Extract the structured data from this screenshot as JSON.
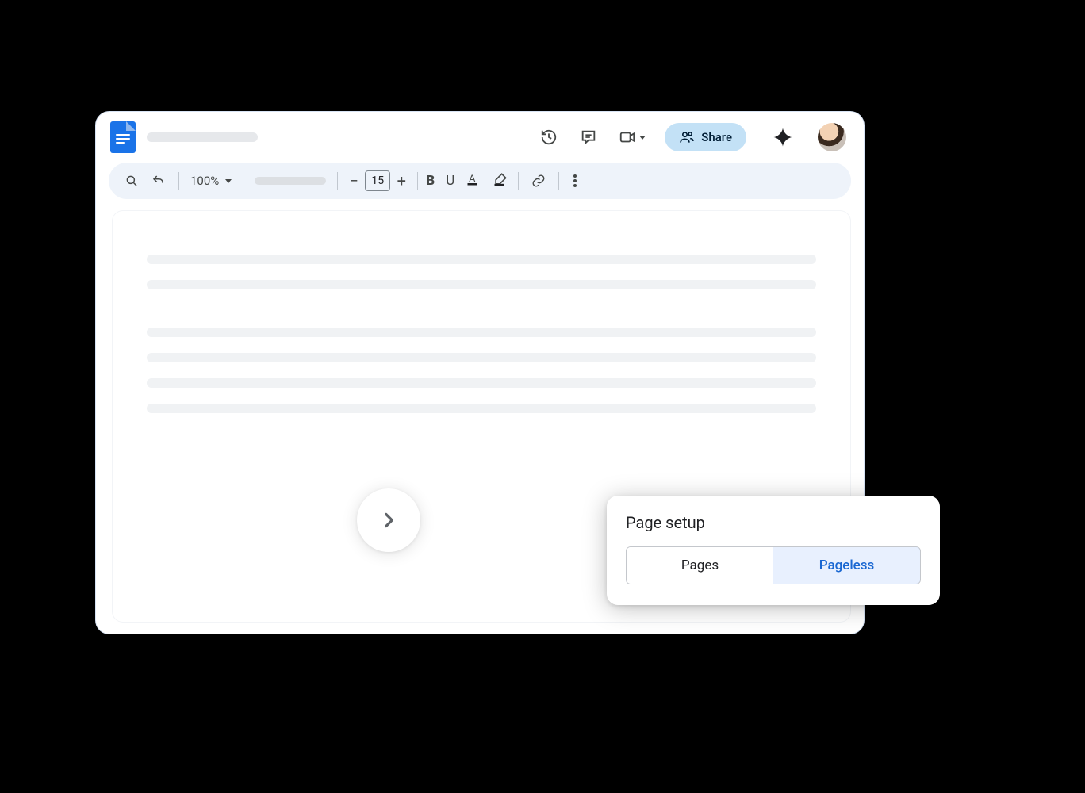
{
  "header": {
    "share_label": "Share"
  },
  "toolbar": {
    "zoom": "100%",
    "font_size": "15"
  },
  "popover": {
    "title": "Page setup",
    "options": {
      "pages": "Pages",
      "pageless": "Pageless"
    },
    "active": "pageless"
  }
}
